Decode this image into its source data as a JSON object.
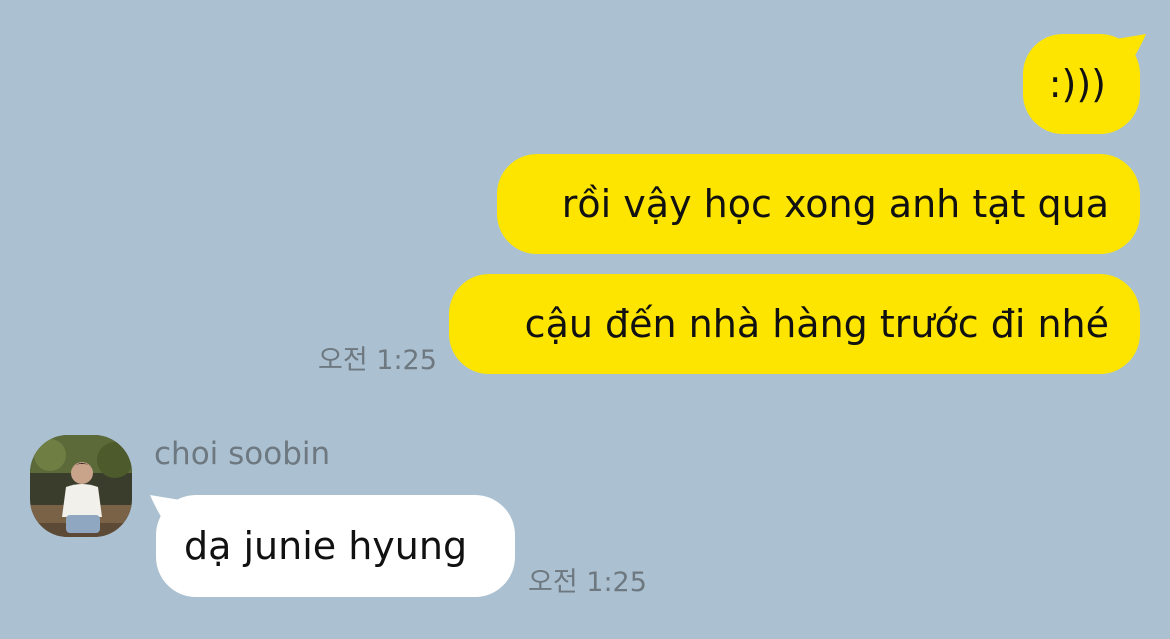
{
  "chat": {
    "outgoing": [
      {
        "text": ":)))"
      },
      {
        "text": "rồi vậy học xong anh tạt qua"
      },
      {
        "text": "cậu đến nhà hàng trước đi nhé"
      }
    ],
    "outgoing_time": "오전 1:25",
    "incoming": {
      "sender_name": "choi soobin",
      "text": "dạ junie hyung",
      "time": "오전 1:25"
    }
  },
  "colors": {
    "background": "#abc1d1",
    "outgoing_bubble": "#fee500",
    "incoming_bubble": "#ffffff",
    "meta_text": "#6e7880"
  }
}
